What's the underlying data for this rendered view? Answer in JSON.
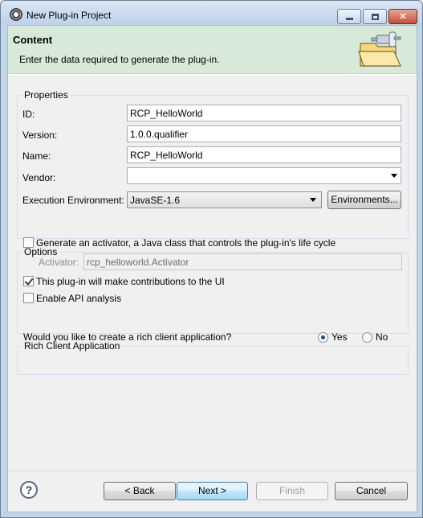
{
  "window": {
    "title": "New Plug-in Project"
  },
  "banner": {
    "title": "Content",
    "description": "Enter the data required to generate the plug-in."
  },
  "properties": {
    "group_label": "Properties",
    "id": {
      "label": "ID:",
      "value": "RCP_HelloWorld"
    },
    "version": {
      "label": "Version:",
      "value": "1.0.0.qualifier"
    },
    "name": {
      "label": "Name:",
      "value": "RCP_HelloWorld"
    },
    "vendor": {
      "label": "Vendor:",
      "value": ""
    },
    "exec_env": {
      "label": "Execution Environment:",
      "value": "JavaSE-1.6",
      "button": "Environments..."
    }
  },
  "options": {
    "group_label": "Options",
    "activator_check": {
      "label": "Generate an activator, a Java class that controls the plug-in's life cycle",
      "checked": false
    },
    "activator_field": {
      "label": "Activator:",
      "value": "rcp_helloworld.Activator"
    },
    "ui_check": {
      "label": "This plug-in will make contributions to the UI",
      "checked": true
    },
    "api_check": {
      "label": "Enable API analysis",
      "checked": false
    }
  },
  "rca": {
    "group_label": "Rich Client Application",
    "question": "Would you like to create a rich client application?",
    "yes": "Yes",
    "no": "No",
    "selected": "Yes"
  },
  "buttons": {
    "back": "< Back",
    "next": "Next >",
    "finish": "Finish",
    "cancel": "Cancel"
  },
  "help_glyph": "?"
}
